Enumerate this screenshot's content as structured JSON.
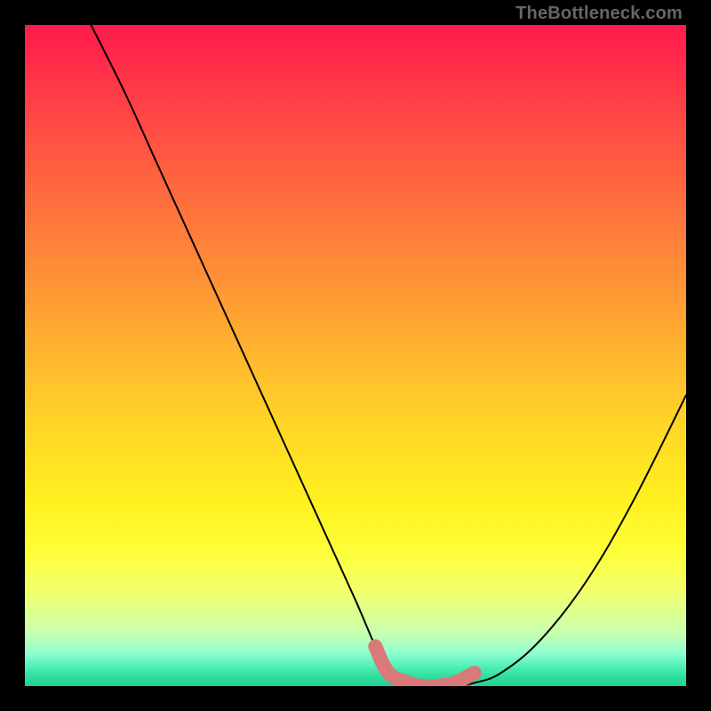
{
  "watermark": "TheBottleneck.com",
  "chart_data": {
    "type": "line",
    "title": "",
    "xlabel": "",
    "ylabel": "",
    "xlim": [
      0,
      100
    ],
    "ylim": [
      0,
      100
    ],
    "series": [
      {
        "name": "bottleneck-curve",
        "x": [
          10,
          15,
          20,
          25,
          30,
          35,
          40,
          45,
          50,
          53,
          55,
          58,
          60,
          62,
          65,
          68,
          72,
          78,
          85,
          92,
          100
        ],
        "values": [
          100,
          90,
          79,
          68,
          57,
          46,
          35,
          24,
          13,
          6,
          2,
          0.5,
          0,
          0,
          0,
          0.5,
          2,
          7,
          16,
          28,
          44
        ]
      }
    ],
    "marker_segment": {
      "name": "optimal-range",
      "color": "#d97a7a",
      "x": [
        53,
        55,
        58,
        60,
        62,
        65,
        68
      ],
      "values": [
        6,
        2,
        0.5,
        0,
        0,
        0.5,
        2
      ]
    }
  }
}
